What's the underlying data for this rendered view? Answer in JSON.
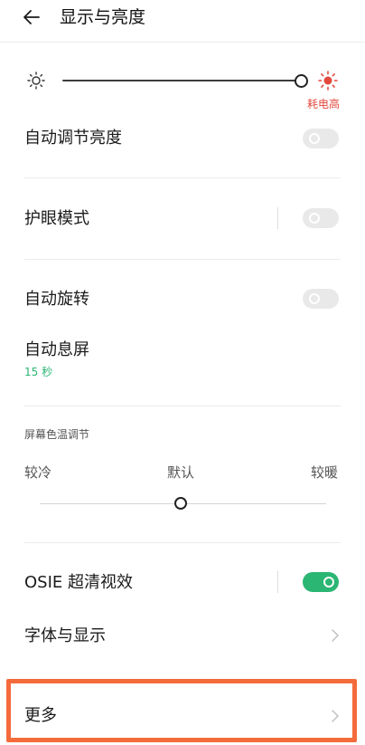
{
  "header": {
    "title": "显示与亮度",
    "back_icon": "arrow-left-icon"
  },
  "brightness": {
    "level": 1.0,
    "low_icon": "sun-outline-icon",
    "high_icon": "sun-filled-icon",
    "power_note": "耗电高",
    "power_note_color": "#e2493e"
  },
  "rows": {
    "auto_brightness": {
      "label": "自动调节亮度",
      "enabled": false
    },
    "eye_protection": {
      "label": "护眼模式",
      "enabled": false
    },
    "auto_rotate": {
      "label": "自动旋转",
      "enabled": false
    },
    "screen_timeout": {
      "label": "自动息屏",
      "value": "15 秒"
    },
    "osie": {
      "label": "OSIE 超清视效",
      "enabled": true
    },
    "font_display": {
      "label": "字体与显示"
    },
    "more": {
      "label": "更多"
    }
  },
  "color_temperature": {
    "section_label": "屏幕色温调节",
    "cool_label": "较冷",
    "default_label": "默认",
    "warm_label": "较暖",
    "level": 0.5
  },
  "colors": {
    "accent": "#2bb673",
    "warning": "#e2493e",
    "highlight": "#f46b3b"
  }
}
